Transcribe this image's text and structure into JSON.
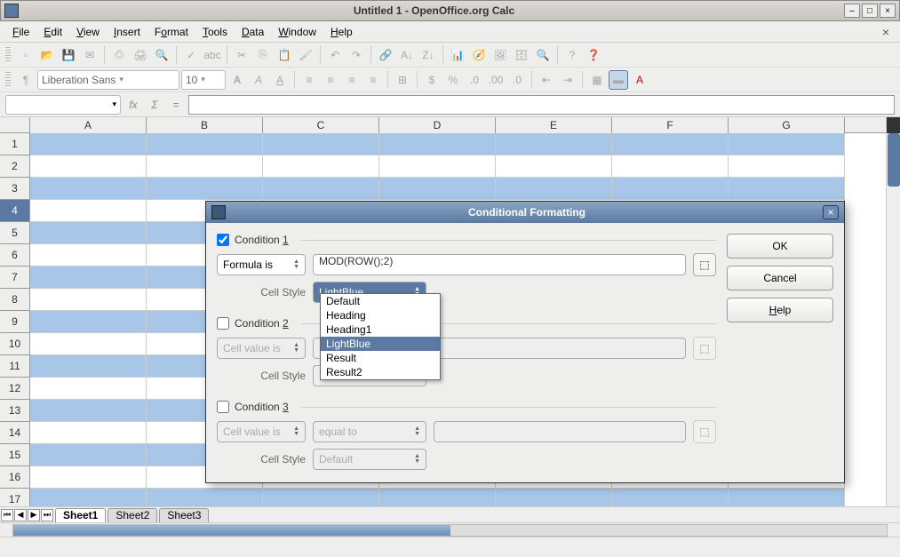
{
  "window": {
    "title": "Untitled 1 - OpenOffice.org Calc"
  },
  "menu": {
    "file": "File",
    "edit": "Edit",
    "view": "View",
    "insert": "Insert",
    "format": "Format",
    "tools": "Tools",
    "data": "Data",
    "window": "Window",
    "help": "Help"
  },
  "format_toolbar": {
    "font": "Liberation Sans",
    "size": "10"
  },
  "formula_bar": {
    "namebox": "",
    "formula": ""
  },
  "columns": [
    "A",
    "B",
    "C",
    "D",
    "E",
    "F",
    "G"
  ],
  "rows": [
    1,
    2,
    3,
    4,
    5,
    6,
    7,
    8,
    9,
    10,
    11,
    12,
    13,
    14,
    15,
    16,
    17
  ],
  "selected_row": 4,
  "tabs": {
    "items": [
      "Sheet1",
      "Sheet2",
      "Sheet3"
    ],
    "active": 0
  },
  "dialog": {
    "title": "Conditional Formatting",
    "buttons": {
      "ok": "OK",
      "cancel": "Cancel",
      "help": "Help"
    },
    "cond1": {
      "label": "Condition 1",
      "checked": true,
      "type": "Formula is",
      "value": "MOD(ROW();2)",
      "style_label": "Cell Style",
      "style": "LightBlue"
    },
    "cond2": {
      "label": "Condition 2",
      "checked": false,
      "type": "Cell value is",
      "op": "",
      "value": "",
      "style_label": "Cell Style",
      "style": ""
    },
    "cond3": {
      "label": "Condition 3",
      "checked": false,
      "type": "Cell value is",
      "op": "equal to",
      "value": "",
      "style_label": "Cell Style",
      "style": "Default"
    },
    "style_options": [
      "Default",
      "Heading",
      "Heading1",
      "LightBlue",
      "Result",
      "Result2"
    ],
    "style_selected": "LightBlue"
  }
}
